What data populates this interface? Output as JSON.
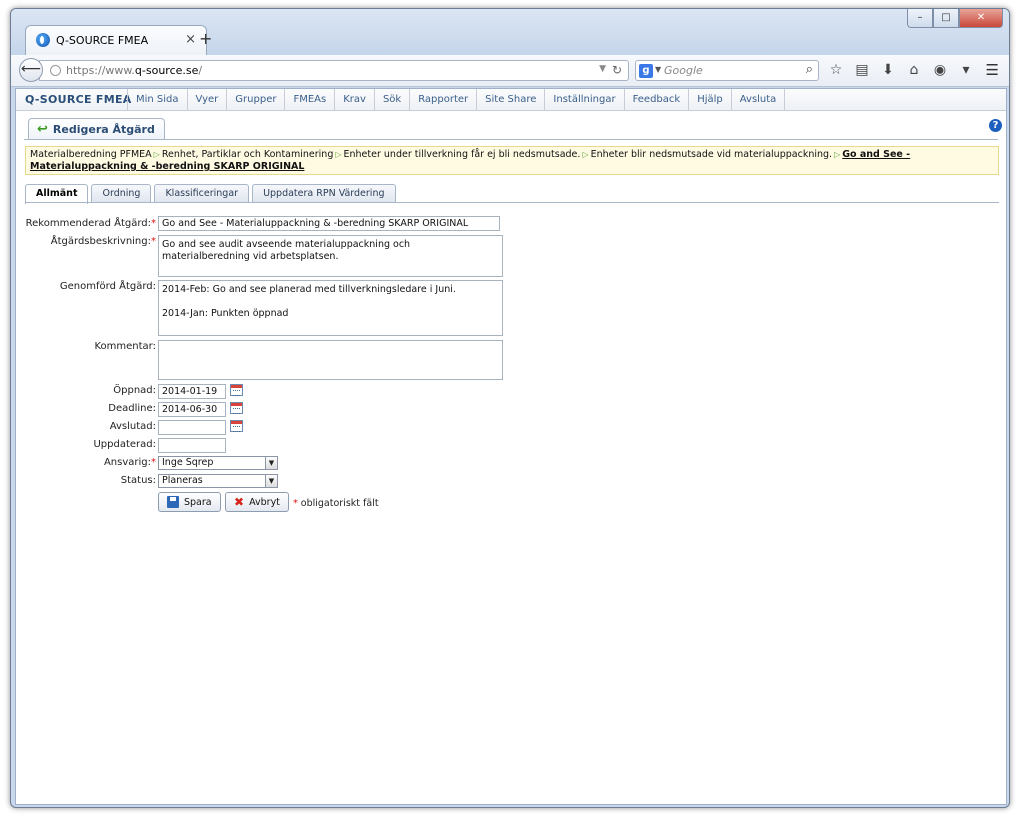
{
  "browser": {
    "tab_title": "Q-SOURCE FMEA",
    "tab_close": "×",
    "new_tab": "+",
    "url_prefix": "https://www.",
    "url_domain": "q-source.se",
    "url_suffix": "/",
    "search_engine": "g",
    "search_placeholder": "Google",
    "window_buttons": {
      "minimize": "–",
      "maximize": "□",
      "close": "✕"
    }
  },
  "app": {
    "brand": "Q-SOURCE FMEA",
    "nav": [
      "Min Sida",
      "Vyer",
      "Grupper",
      "FMEAs",
      "Krav",
      "Sök",
      "Rapporter",
      "Site Share",
      "Inställningar",
      "Feedback",
      "Hjälp",
      "Avsluta"
    ]
  },
  "page": {
    "tab_title": "Redigera Åtgärd",
    "help": "?",
    "breadcrumb": [
      "Materialberedning PFMEA",
      "Renhet, Partiklar och Kontaminering",
      "Enheter under tillverkning får ej bli nedsmutsade.",
      "Enheter blir nedsmutsade vid materialuppackning."
    ],
    "breadcrumb_current": "Go and See - Materialuppackning & -beredning SKARP ORIGINAL",
    "form_tabs": [
      "Allmänt",
      "Ordning",
      "Klassificeringar",
      "Uppdatera RPN Värdering"
    ],
    "active_tab": "Allmänt"
  },
  "form": {
    "rekommenderad_label": "Rekommenderad Åtgärd:",
    "rekommenderad_value": "Go and See - Materialuppackning & -beredning SKARP ORIGINAL",
    "beskrivning_label": "Åtgärdsbeskrivning:",
    "beskrivning_value": "Go and see audit avseende materialuppackning och materialberedning vid arbetsplatsen.",
    "genomford_label": "Genomförd Åtgärd:",
    "genomford_value": "2014-Feb: Go and see planerad med tillverkningsledare i Juni.\n\n2014-Jan: Punkten öppnad",
    "kommentar_label": "Kommentar:",
    "kommentar_value": "",
    "oppnad_label": "Öppnad:",
    "oppnad_value": "2014-01-19",
    "deadline_label": "Deadline:",
    "deadline_value": "2014-06-30",
    "avslutad_label": "Avslutad:",
    "avslutad_value": "",
    "uppdaterad_label": "Uppdaterad:",
    "uppdaterad_value": "",
    "ansvarig_label": "Ansvarig:",
    "ansvarig_value": "Inge Sqrep",
    "status_label": "Status:",
    "status_value": "Planeras",
    "required_mark": "*",
    "save_label": "Spara",
    "cancel_label": "Avbryt",
    "required_note": "obligatoriskt fält"
  }
}
